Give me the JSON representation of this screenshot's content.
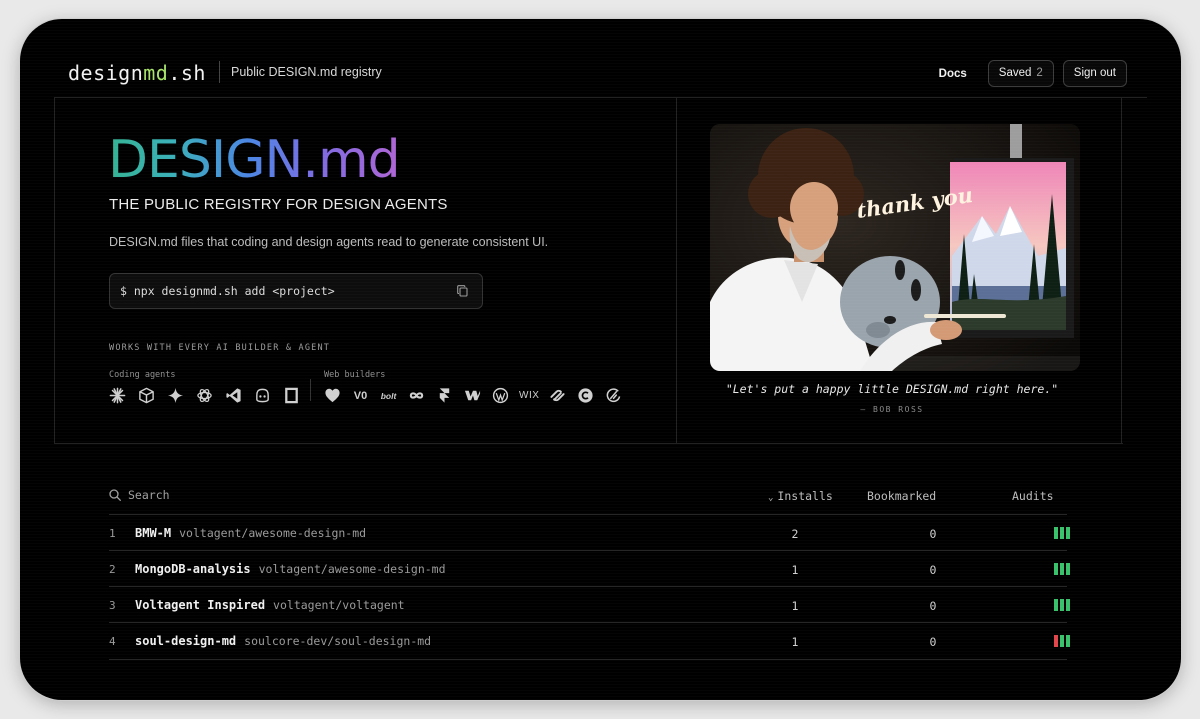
{
  "header": {
    "logo_prefix": "design",
    "logo_accent": "md",
    "logo_suffix": ".sh",
    "tagline": "Public DESIGN.md registry",
    "docs": "Docs",
    "saved_label": "Saved",
    "saved_count": "2",
    "signout": "Sign out"
  },
  "hero": {
    "title": "DESIGN.md",
    "subtitle": "THE PUBLIC REGISTRY FOR DESIGN AGENTS",
    "description": "DESIGN.md files that coding and design agents read to generate consistent UI.",
    "command": "$ npx designmd.sh add <project>",
    "works_with": "WORKS WITH EVERY AI BUILDER & AGENT",
    "coding_label": "Coding agents",
    "web_label": "Web builders",
    "coding_icons": [
      "claude-icon",
      "cube-icon",
      "sparkle-icon",
      "openai-icon",
      "vscode-icon",
      "copilot-icon",
      "square-frame-icon"
    ],
    "web_icons": [
      "lovable-icon",
      "v0-icon",
      "bolt-icon",
      "infinity-icon",
      "framer-icon",
      "webflow-icon",
      "wordpress-icon",
      "wix-icon",
      "squarespace-icon",
      "copyright-icon",
      "replit-icon"
    ],
    "web_text": {
      "v0": "V0",
      "bolt": "bolt",
      "wix": "WIX"
    }
  },
  "picture": {
    "overlay_text": "thank you",
    "quote": "\"Let's put a happy little DESIGN.md right here.\"",
    "attribution": "— BOB ROSS"
  },
  "table": {
    "search_placeholder": "Search",
    "sort_indicator": "⌄",
    "columns": {
      "installs": "Installs",
      "bookmarked": "Bookmarked",
      "audits": "Audits"
    },
    "rows": [
      {
        "rank": "1",
        "name": "BMW-M",
        "source": "voltagent/awesome-design-md",
        "installs": "2",
        "bookmarked": "0",
        "audit_colors": [
          "#39c16b",
          "#39c16b",
          "#39c16b"
        ]
      },
      {
        "rank": "2",
        "name": "MongoDB-analysis",
        "source": "voltagent/awesome-design-md",
        "installs": "1",
        "bookmarked": "0",
        "audit_colors": [
          "#39c16b",
          "#39c16b",
          "#39c16b"
        ]
      },
      {
        "rank": "3",
        "name": "Voltagent Inspired",
        "source": "voltagent/voltagent",
        "installs": "1",
        "bookmarked": "0",
        "audit_colors": [
          "#39c16b",
          "#39c16b",
          "#39c16b"
        ]
      },
      {
        "rank": "4",
        "name": "soul-design-md",
        "source": "soulcore-dev/soul-design-md",
        "installs": "1",
        "bookmarked": "0",
        "audit_colors": [
          "#e0464b",
          "#39c16b",
          "#39c16b"
        ]
      }
    ]
  },
  "colors": {
    "accent": "#a7e36b",
    "audit_pass": "#39c16b",
    "audit_fail": "#e0464b"
  }
}
